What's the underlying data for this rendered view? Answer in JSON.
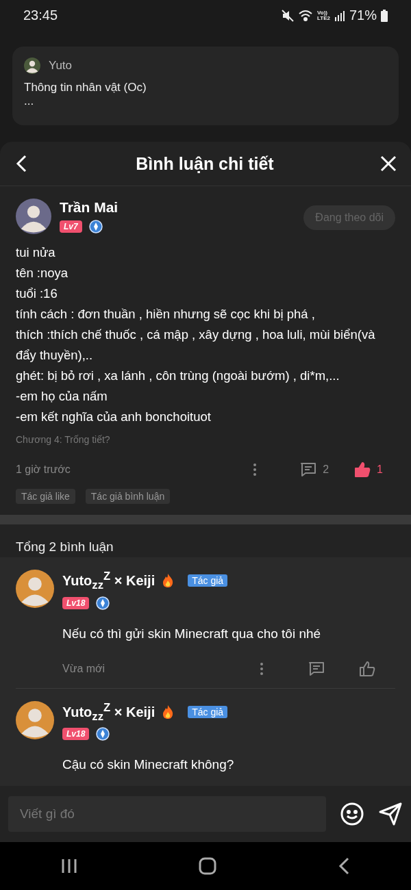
{
  "status_bar": {
    "time": "23:45",
    "network": "Vo))\nLTE2",
    "battery": "71%"
  },
  "background_post": {
    "author": "Yuto",
    "title": "Thông tin nhân vật (Oc)",
    "excerpt": "..."
  },
  "sheet": {
    "title": "Bình luận chi tiết"
  },
  "comment": {
    "author": "Trần Mai",
    "level": "Lv7",
    "follow_label": "Đang theo dõi",
    "following": true,
    "lines": [
      "tui nửa",
      "tên :noya",
      "tuổi :16",
      "tính cách : đơn thuần , hiền nhưng sẽ cọc khi bị phá ,",
      "thích :thích chế thuốc , cá mập , xây dựng , hoa luli, mùi biển(và đẩy thuyền),..",
      "ghét: bị bỏ rơi , xa lánh , côn trùng (ngoài bướm) , di*m,...",
      "-em họ của nấm",
      "-em kết nghĩa của anh bonchoituot"
    ],
    "chapter": "Chương 4: Trống tiết?",
    "time": "1 giờ trước",
    "reply_count": "2",
    "like_count": "1",
    "liked": true,
    "tags": [
      "Tác giả like",
      "Tác giả bình luận"
    ]
  },
  "replies_header": "Tổng 2 bình luận",
  "replies": [
    {
      "author": "Yuto$_{zz}$$^{Z}$ × Keiji",
      "role": "Tác giả",
      "level": "Lv18",
      "text": "Nếu có thì gửi skin Minecraft qua cho tôi nhé",
      "time": "Vừa mới"
    },
    {
      "author": "Yuto$_{zz}$$^{Z}$ × Keiji",
      "role": "Tác giả",
      "level": "Lv18",
      "text": "Cậu có skin Minecraft không?"
    }
  ],
  "input": {
    "placeholder": "Viết gì đó"
  }
}
